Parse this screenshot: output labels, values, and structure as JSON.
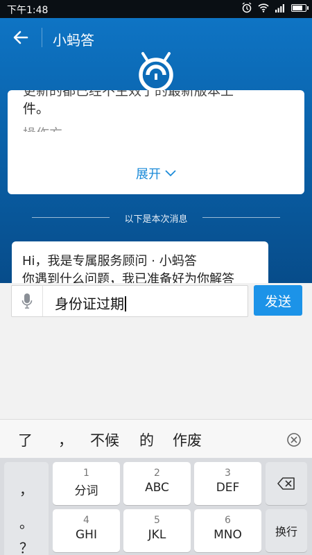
{
  "status_bar": {
    "time": "下午1:48"
  },
  "app_bar": {
    "title": "小蚂答"
  },
  "history_card": {
    "cut_line": "更新的都已经不生效了的最新版本上",
    "line2": "件。",
    "ghost_line": "操作方",
    "expand_label": "展开"
  },
  "separator": {
    "label": "以下是本次消息"
  },
  "message": {
    "line1": "Hi，我是专属服务顾问 · 小蚂答",
    "line2": "你遇到什么问题，我已准备好为你解答"
  },
  "input": {
    "value": "身份证过期"
  },
  "send": {
    "label": "发送"
  },
  "candidates": [
    "了",
    "，",
    "不候",
    "的",
    "作废"
  ],
  "keyboard": {
    "punct": [
      "，",
      "。",
      "？"
    ],
    "keys": [
      {
        "num": "1",
        "label": "分词"
      },
      {
        "num": "2",
        "label": "ABC"
      },
      {
        "num": "3",
        "label": "DEF"
      },
      {
        "num": "4",
        "label": "GHI"
      },
      {
        "num": "5",
        "label": "JKL"
      },
      {
        "num": "6",
        "label": "MNO"
      }
    ],
    "newline_label": "换行"
  },
  "colors": {
    "header_blue": "#0e74c4",
    "accent": "#1c93e8",
    "link": "#1a8ad8"
  }
}
